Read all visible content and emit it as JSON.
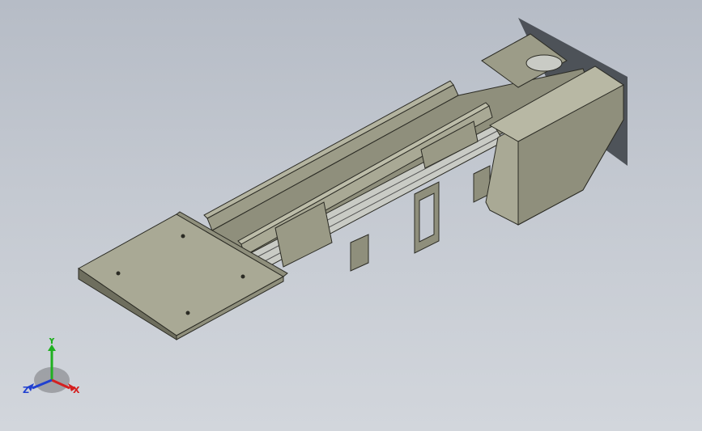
{
  "colors": {
    "background_top": "#b6bcc6",
    "background_bottom": "#d2d6dc",
    "part_light": "#a9a995",
    "part_mid": "#8f8f7c",
    "part_dark": "#6e6e5e",
    "edge": "#2b2b24",
    "shadow": "#3a3e44",
    "rail_metal": "#c9cbc5",
    "axis_x": "#d42020",
    "axis_y": "#20b020",
    "axis_z": "#2040d0"
  },
  "triad": {
    "x_label": "X",
    "y_label": "Y",
    "z_label": "Z",
    "icon": "coordinate-triad-icon"
  }
}
